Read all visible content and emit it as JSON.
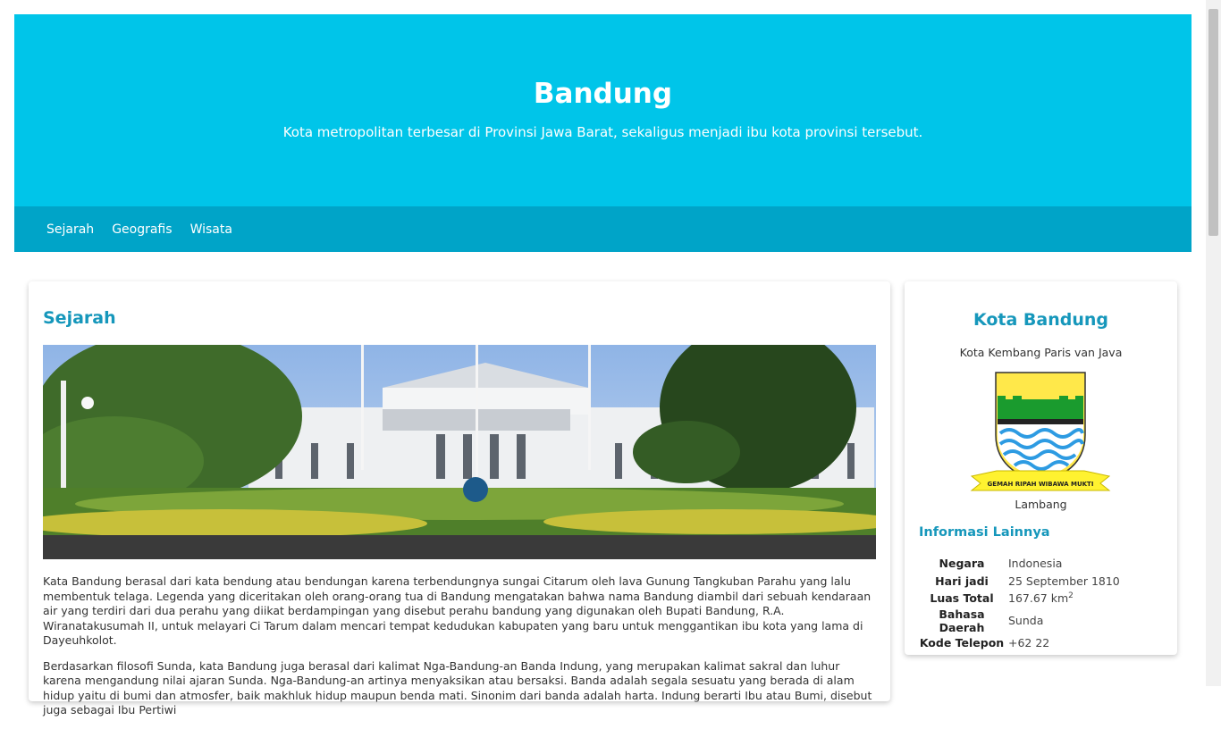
{
  "hero": {
    "title": "Bandung",
    "subtitle": "Kota metropolitan terbesar di Provinsi Jawa Barat, sekaligus menjadi ibu kota provinsi tersebut."
  },
  "nav": {
    "items": [
      "Sejarah",
      "Geografis",
      "Wisata"
    ]
  },
  "main": {
    "heading": "Sejarah",
    "paragraphs": [
      "Kata Bandung berasal dari kata bendung atau bendungan karena terbendungnya sungai Citarum oleh lava Gunung Tangkuban Parahu yang lalu membentuk telaga. Legenda yang diceritakan oleh orang-orang tua di Bandung mengatakan bahwa nama Bandung diambil dari sebuah kendaraan air yang terdiri dari dua perahu yang diikat berdampingan yang disebut perahu bandung yang digunakan oleh Bupati Bandung, R.A. Wiranatakusumah II, untuk melayari Ci Tarum dalam mencari tempat kedudukan kabupaten yang baru untuk menggantikan ibu kota yang lama di Dayeuhkolot.",
      "Berdasarkan filosofi Sunda, kata Bandung juga berasal dari kalimat Nga-Bandung-an Banda Indung, yang merupakan kalimat sakral dan luhur karena mengandung nilai ajaran Sunda. Nga-Bandung-an artinya menyaksikan atau bersaksi. Banda adalah segala sesuatu yang berada di alam hidup yaitu di bumi dan atmosfer, baik makhluk hidup maupun benda mati. Sinonim dari banda adalah harta. Indung berarti Ibu atau Bumi, disebut juga sebagai Ibu Pertiwi"
    ]
  },
  "aside": {
    "title": "Kota Bandung",
    "motto": "Kota Kembang Paris van Java",
    "emblem_ribbon": "GEMAH RIPAH WIBAWA MUKTI",
    "emblem_caption": "Lambang",
    "info_heading": "Informasi Lainnya",
    "info": [
      {
        "key": "Negara",
        "value": "Indonesia"
      },
      {
        "key": "Hari jadi",
        "value": "25 September 1810"
      },
      {
        "key": "Luas Total",
        "value": "167.67 km",
        "sup": "2"
      },
      {
        "key": "Bahasa Daerah",
        "value": "Sunda"
      },
      {
        "key": "Kode Telepon",
        "value": "+62 22"
      }
    ]
  },
  "colors": {
    "hero_bg": "#00c5e9",
    "nav_bg": "#00a4c8",
    "heading": "#1697bb"
  }
}
